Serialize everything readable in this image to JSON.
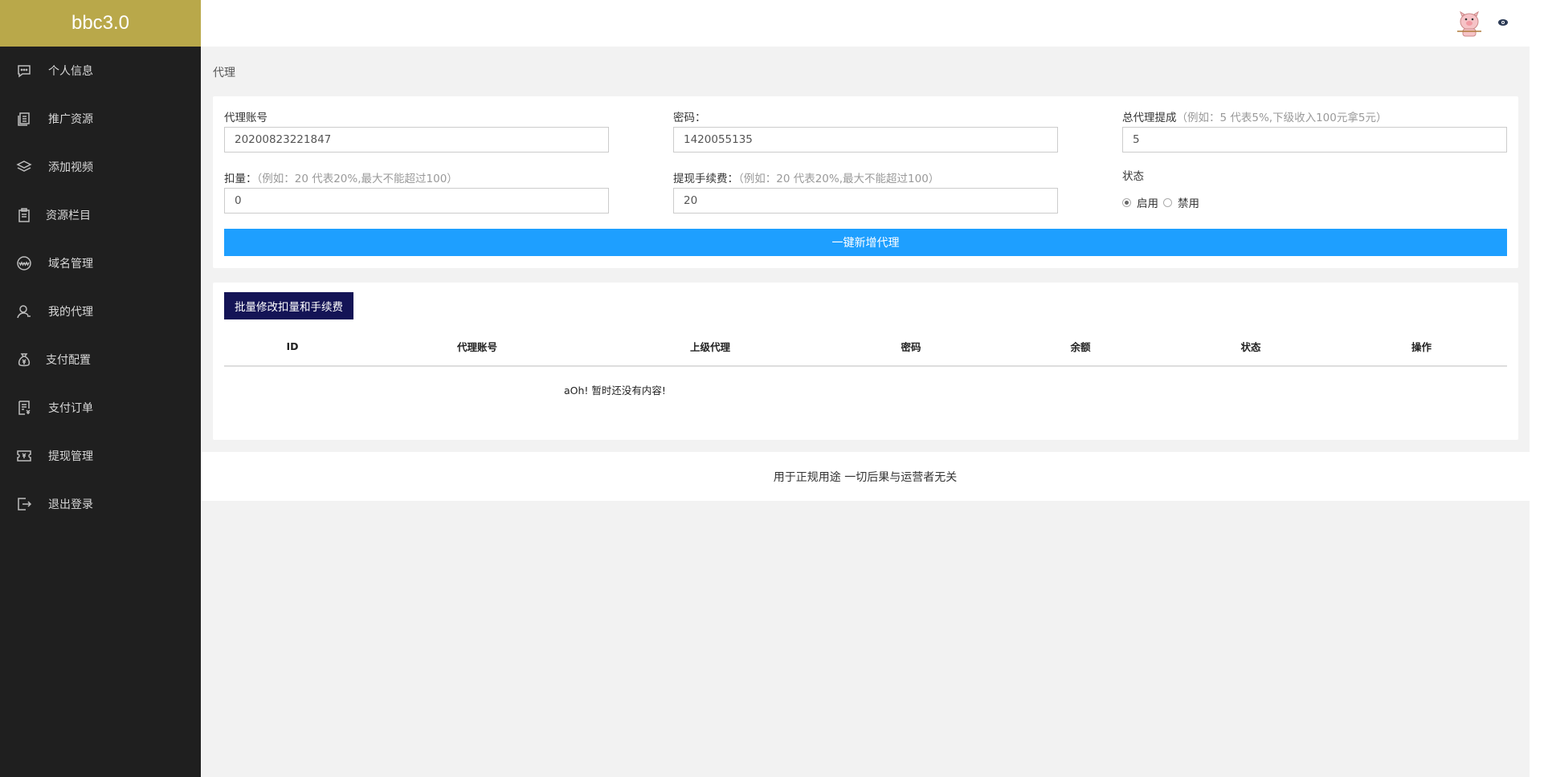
{
  "app": {
    "brand": "bbc3.0"
  },
  "sidebar": {
    "items": [
      {
        "label": "个人信息",
        "icon": "chat-icon"
      },
      {
        "label": "推广资源",
        "icon": "stack-docs-icon"
      },
      {
        "label": "添加视频",
        "icon": "layers-icon"
      },
      {
        "label": "资源栏目",
        "icon": "clipboard-icon"
      },
      {
        "label": "域名管理",
        "icon": "www-icon"
      },
      {
        "label": "我的代理",
        "icon": "user-icon"
      },
      {
        "label": "支付配置",
        "icon": "money-bag-icon"
      },
      {
        "label": "支付订单",
        "icon": "receipt-icon"
      },
      {
        "label": "提现管理",
        "icon": "ticket-icon"
      },
      {
        "label": "退出登录",
        "icon": "logout-icon"
      }
    ]
  },
  "breadcrumb": "代理",
  "form": {
    "account": {
      "label": "代理账号",
      "value": "20200823221847"
    },
    "password": {
      "label": "密码：",
      "value": "1420055135"
    },
    "commission": {
      "label": "总代理提成",
      "hint": "（例如：5 代表5%,下级收入100元拿5元）",
      "value": "5"
    },
    "deduction": {
      "label": "扣量：",
      "hint": "（例如：20 代表20%,最大不能超过100）",
      "value": "0"
    },
    "fee": {
      "label": "提现手续费：",
      "hint": "（例如：20 代表20%,最大不能超过100）",
      "value": "20"
    },
    "status": {
      "label": "状态",
      "options": [
        "启用",
        "禁用"
      ],
      "selected": "启用"
    },
    "submit_label": "一键新增代理"
  },
  "table": {
    "batch_button": "批量修改扣量和手续费",
    "columns": [
      "ID",
      "代理账号",
      "上级代理",
      "密码",
      "余额",
      "状态",
      "操作"
    ],
    "empty_text": "aOh! 暂时还没有内容!"
  },
  "footer": "用于正规用途 一切后果与运营者无关",
  "colors": {
    "brand": "#b9a84a",
    "sidebar": "#1f1f1f",
    "primary": "#1e9fff",
    "batch": "#141456"
  }
}
